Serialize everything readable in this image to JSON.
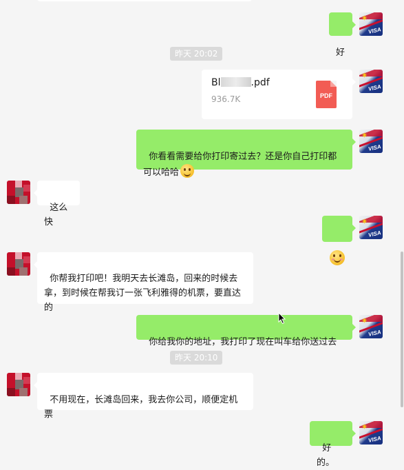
{
  "messages": {
    "m1": {
      "text": "好"
    },
    "ts1": {
      "text": "昨天 20:02"
    },
    "file": {
      "name_start": "Bl",
      "name_end": ".pdf",
      "size": "936.7K",
      "icon_label": "PDF"
    },
    "m3": {
      "text": "你看看需要给你打印寄过去？还是你自己打印都可以哈哈"
    },
    "m4": {
      "text": "这么快"
    },
    "m6": {
      "text": "你帮我打印吧！我明天去长滩岛，回来的时候去拿，到时候在帮我订一张飞利雅得的机票，要直达的"
    },
    "m7": {
      "text": "你给我你的地址，我打印了现在叫车给你送过去"
    },
    "ts2": {
      "text": "昨天 20:10"
    },
    "m8": {
      "text": "不用现在，长滩岛回来，我去你公司，顺便定机票"
    },
    "m9": {
      "text": "好的。"
    }
  },
  "avatars": {
    "me_label": "VISA"
  },
  "icons": {
    "me_avatar": "passport-visa-avatar",
    "them_avatar": "pixelated-avatar",
    "file_type": "pdf-file-icon",
    "emoji_smile": "smile-emoji",
    "emoji_blush": "blush-emoji"
  },
  "colors": {
    "my_bubble": "#95ec69",
    "their_bubble": "#ffffff",
    "background": "#f5f5f5",
    "pdf_red": "#f25c54"
  }
}
